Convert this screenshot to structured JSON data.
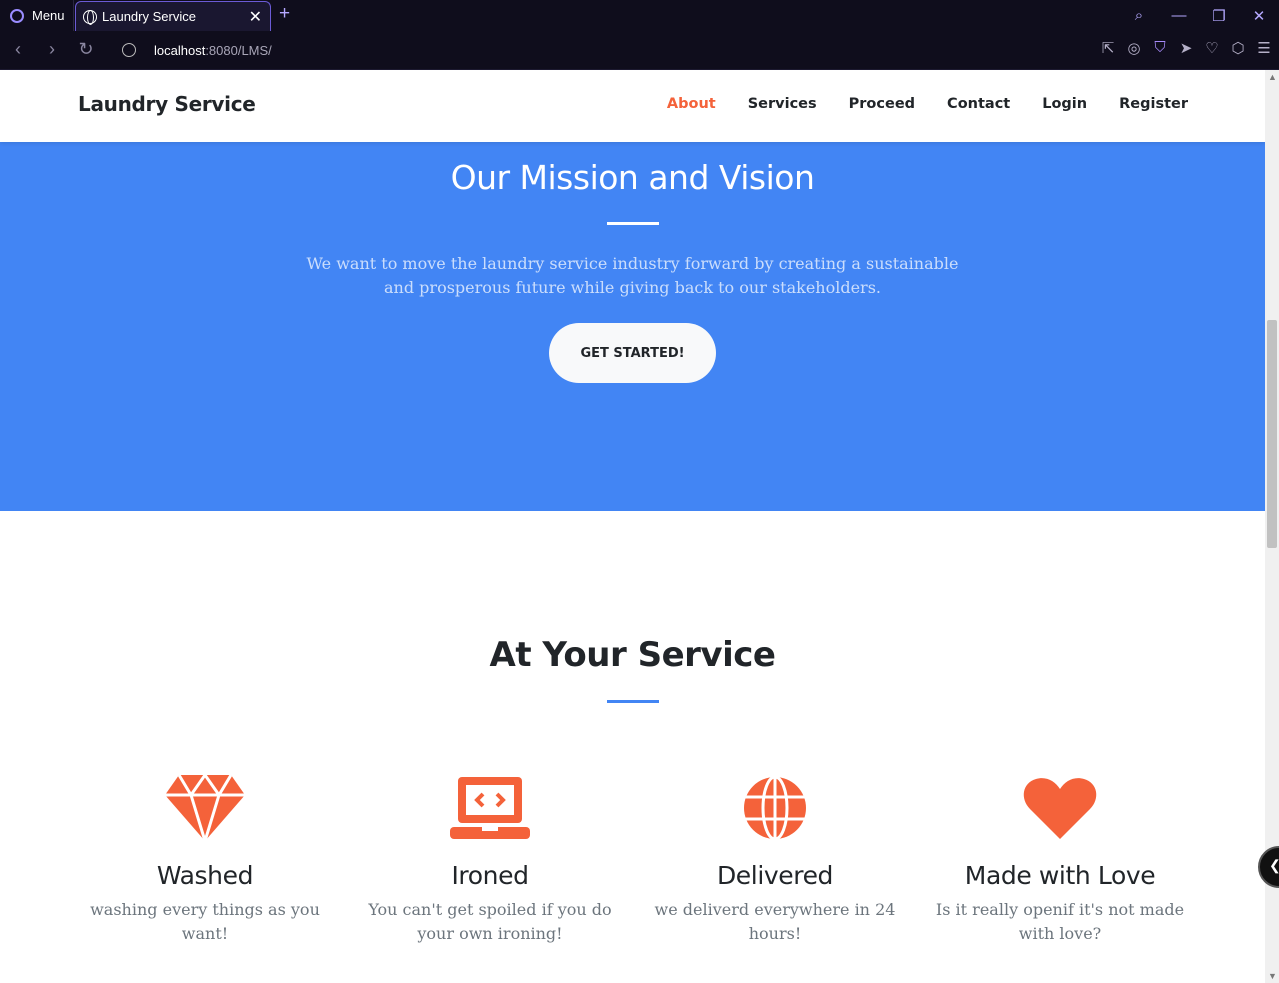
{
  "browser": {
    "menu_label": "Menu",
    "tab_title": "Laundry Service",
    "url_host": "localhost",
    "url_path": ":8080/LMS/"
  },
  "site": {
    "brand": "Laundry Service",
    "nav": [
      {
        "label": "About",
        "active": true
      },
      {
        "label": "Services"
      },
      {
        "label": "Proceed"
      },
      {
        "label": "Contact"
      },
      {
        "label": "Login"
      },
      {
        "label": "Register"
      }
    ]
  },
  "hero": {
    "title": "Our Mission and Vision",
    "text": "We want to move the laundry service industry forward by creating a sustainable and prosperous future while giving back to our stakeholders.",
    "cta": "GET STARTED!",
    "bg_color": "#4285f4"
  },
  "services": {
    "title": "At Your Service",
    "accent_color": "#f4623a",
    "items": [
      {
        "icon": "gem-icon",
        "title": "Washed",
        "text": "washing every things as you want!"
      },
      {
        "icon": "laptop-code-icon",
        "title": "Ironed",
        "text": "You can't get spoiled if you do your own ironing!"
      },
      {
        "icon": "globe-icon",
        "title": "Delivered",
        "text": "we deliverd everywhere in 24 hours!"
      },
      {
        "icon": "heart-icon",
        "title": "Made with Love",
        "text": "Is it really openif it's not made with love?"
      }
    ]
  }
}
